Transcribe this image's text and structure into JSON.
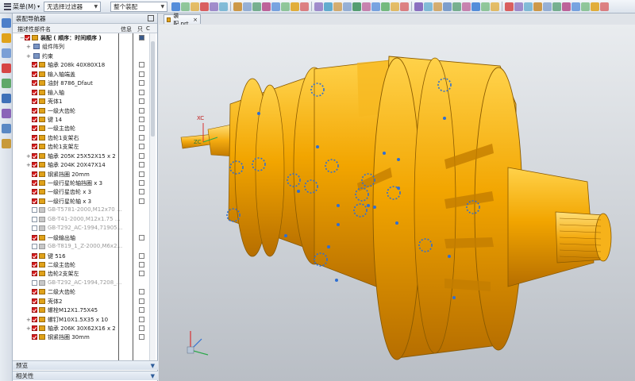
{
  "toolbar": {
    "menu_label": "菜单(M)",
    "filter_combo": "无选择过滤器",
    "scope_combo": "整个装配"
  },
  "navigator": {
    "title": "装配导航器",
    "col_name": "描述性部件名",
    "col_info": "信息",
    "col_read": "只",
    "col_c": "C"
  },
  "tree_items": [
    {
      "label": "装配 ( 顺序：时间顺序 )",
      "checked": true,
      "gray": false
    },
    {
      "label": "组件阵列",
      "checked": false,
      "gray": false
    },
    {
      "label": "约束",
      "checked": false,
      "gray": false
    },
    {
      "label": "轴承 208k 40X80X18",
      "checked": true,
      "gray": false
    },
    {
      "label": "输入轴端盖",
      "checked": true,
      "gray": false
    },
    {
      "label": "油封 8786_Dfaut",
      "checked": true,
      "gray": false
    },
    {
      "label": "输入轴",
      "checked": true,
      "gray": false
    },
    {
      "label": "壳体1",
      "checked": true,
      "gray": false
    },
    {
      "label": "一级大齿轮",
      "checked": true,
      "gray": false
    },
    {
      "label": "键 14",
      "checked": true,
      "gray": false
    },
    {
      "label": "一级主齿轮",
      "checked": true,
      "gray": false
    },
    {
      "label": "齿轮1支架右",
      "checked": true,
      "gray": false
    },
    {
      "label": "齿轮1支架左",
      "checked": true,
      "gray": false
    },
    {
      "label": "轴承 205K 25X52X15 x 2",
      "checked": true,
      "gray": false
    },
    {
      "label": "轴承 204K 20X47X14",
      "checked": true,
      "gray": false
    },
    {
      "label": "钢紧挡圈 20mm",
      "checked": true,
      "gray": false
    },
    {
      "label": "一级行星轮轴挡圈 x 3",
      "checked": true,
      "gray": false
    },
    {
      "label": "一级行星齿轮 x 3",
      "checked": true,
      "gray": false
    },
    {
      "label": "一级行星轮轴 x 3",
      "checked": true,
      "gray": false
    },
    {
      "label": "GB-T5781-2000,M12x70 ...",
      "checked": false,
      "gray": true
    },
    {
      "label": "GB-T41-2000,M12x1.75 ...",
      "checked": false,
      "gray": true
    },
    {
      "label": "GB-T292_AC-1994,71905...",
      "checked": false,
      "gray": true
    },
    {
      "label": "一级输出轴",
      "checked": true,
      "gray": false
    },
    {
      "label": "GB-T819_1_Z-2000,M6x2...",
      "checked": false,
      "gray": true
    },
    {
      "label": "键 516",
      "checked": true,
      "gray": false
    },
    {
      "label": "二级主齿轮",
      "checked": true,
      "gray": false
    },
    {
      "label": "齿轮2支架左",
      "checked": true,
      "gray": false
    },
    {
      "label": "GB-T292_AC-1994,7208_...",
      "checked": false,
      "gray": true
    },
    {
      "label": "二级大齿轮",
      "checked": true,
      "gray": false
    },
    {
      "label": "壳体2",
      "checked": true,
      "gray": false
    },
    {
      "label": "螺栓M12X1.75X45",
      "checked": true,
      "gray": false
    },
    {
      "label": "螺钉M10X1.5X35 x 10",
      "checked": true,
      "gray": false
    },
    {
      "label": "轴承 206K 30X62X16 x 2",
      "checked": true,
      "gray": false
    },
    {
      "label": "钢紧挡圈 30mm",
      "checked": true,
      "gray": false
    }
  ],
  "accordion": {
    "preview": "预览",
    "related": "相关性"
  },
  "tab": {
    "label": "装配.prt"
  },
  "viewport": {
    "triad_xc": "XC",
    "triad_zc": "ZC"
  },
  "colors": {
    "part_orange": "#f2a500",
    "constraint_blue": "#2f6fd2"
  }
}
